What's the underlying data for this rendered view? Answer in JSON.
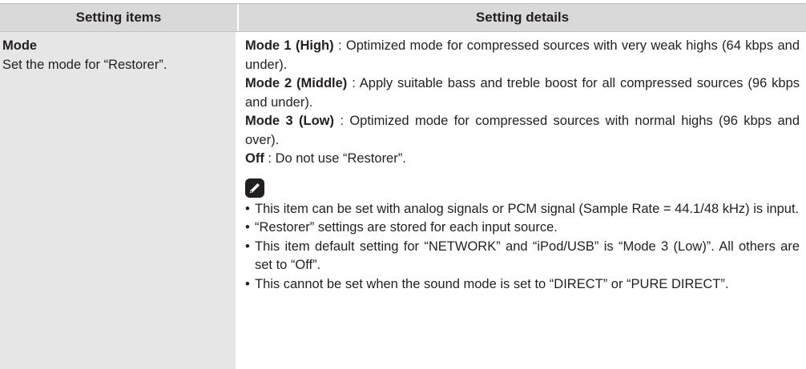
{
  "header": {
    "left": "Setting items",
    "right": "Setting details"
  },
  "item": {
    "title": "Mode",
    "description": "Set the mode for “Restorer”."
  },
  "details": [
    {
      "label": "Mode 1 (High)",
      "text": " : Optimized mode for compressed sources with very weak highs (64 kbps and under)."
    },
    {
      "label": "Mode 2 (Middle)",
      "text": " : Apply suitable bass and treble boost for all compressed sources (96 kbps and under)."
    },
    {
      "label": "Mode 3 (Low)",
      "text": " : Optimized mode for compressed sources with normal highs (96 kbps and over)."
    },
    {
      "label": "Off",
      "text": " : Do not use “Restorer”."
    }
  ],
  "note_icon": "pencil-icon",
  "notes": [
    "This item can be set with analog signals or PCM signal (Sample Rate = 44.1/48 kHz) is input.",
    "“Restorer” settings are stored for each input source.",
    "This item default setting for “NETWORK” and “iPod/USB” is “Mode 3 (Low)”. All others are set to “Off”.",
    "This cannot be set when the sound mode is set to “DIRECT” or “PURE DIRECT”."
  ]
}
